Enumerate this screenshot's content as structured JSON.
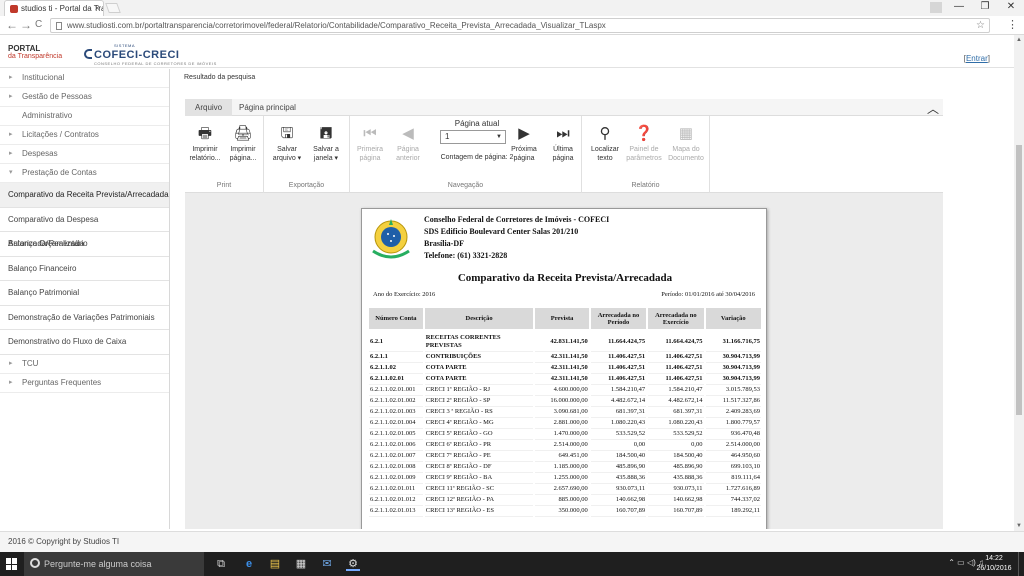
{
  "browser": {
    "tab_title": "studios ti - Portal da Tra",
    "tab_close": "×",
    "window_controls": [
      "—",
      "❐",
      "✕"
    ],
    "nav_back": "←",
    "nav_forward": "→",
    "nav_reload": "C",
    "url": "www.studiosti.com.br/portaltransparencia/corretorimovel/federal/Relatorio/Contabilidade/Comparativo_Receita_Prevista_Arrecadada_Visualizar_TLaspx",
    "star": "☆",
    "menu": "⋮"
  },
  "header": {
    "logo_line1": "PORTAL",
    "logo_line2": "da Transparência",
    "brand_system": "SISTEMA",
    "brand_name": "COFECI-CRECI",
    "brand_sub": "CONSELHO FEDERAL DE CORRETORES DE IMÓVEIS",
    "login_open": "[",
    "login_label": "Entrar",
    "login_close": "]"
  },
  "sidebar": {
    "sections": [
      {
        "label": "Institucional",
        "caret": "▸"
      },
      {
        "label": "Gestão de Pessoas",
        "caret": "▸"
      },
      {
        "label": "Administrativo",
        "caret": ""
      },
      {
        "label": "Licitações / Contratos",
        "caret": "▸"
      },
      {
        "label": "Despesas",
        "caret": "▸"
      },
      {
        "label": "Prestação de Contas",
        "caret": "▾"
      }
    ],
    "links": [
      "Comparativo da Receita Prevista/Arrecadada",
      "Comparativo da Despesa Autorizada/Realizada",
      "Balanço Orçamentário",
      "Balanço Financeiro",
      "Balanço Patrimonial",
      "Demonstração de Variações Patrimoniais",
      "Demonstrativo do Fluxo de Caixa"
    ],
    "tail_sections": [
      {
        "label": "TCU",
        "caret": "▸"
      },
      {
        "label": "Perguntas Frequentes",
        "caret": "▸"
      }
    ]
  },
  "content": {
    "result_title": "Resultado da pesquisa"
  },
  "viewer": {
    "tabs": [
      "Arquivo",
      "Página principal"
    ],
    "collapse_icon": "︿",
    "groups": {
      "print": "Print",
      "export": "Exportação",
      "nav": "Navegação",
      "report": "Relatório"
    },
    "buttons": {
      "print_report": [
        "Imprimir",
        "relatório..."
      ],
      "print_page": [
        "Imprimir",
        "página..."
      ],
      "save_file": [
        "Salvar",
        "arquivo ▾"
      ],
      "save_window": [
        "Salvar a",
        "janela ▾"
      ],
      "first_page": [
        "Primeira",
        "página"
      ],
      "prev_page": [
        "Página",
        "anterior"
      ],
      "next_page": [
        "Próxima",
        "página"
      ],
      "last_page": [
        "Última",
        "página"
      ],
      "find_text": [
        "Localizar",
        "texto"
      ],
      "param_panel": [
        "Painel de",
        "parâmetros"
      ],
      "doc_map": [
        "Mapa do",
        "Documento"
      ]
    },
    "page_label": "Página atual",
    "page_value": "1",
    "page_count": "Contagem de página: 2"
  },
  "report": {
    "org_lines": [
      "Conselho Federal de Corretores de Imóveis -  COFECI",
      "SDS Edificio Boulevard Center Salas 201/210",
      "Brasília-DF",
      "Telefone: (61) 3321-2828"
    ],
    "title": "Comparativo da Receita Prevista/Arrecadada",
    "ano": "Ano do Exercício: 2016",
    "periodo": "Período: 01/01/2016 até 30/04/2016",
    "columns": [
      "Número Conta",
      "Descrição",
      "Prevista",
      "Arrecadada no Período",
      "Arrecadada no Exercício",
      "Variação"
    ],
    "rows": [
      [
        "6.2.1",
        "RECEITAS CORRENTES PREVISTAS",
        "42.831.141,50",
        "11.664.424,75",
        "11.664.424,75",
        "31.166.716,75"
      ],
      [
        "6.2.1.1",
        "CONTRIBUIÇÕES",
        "42.311.141,50",
        "11.406.427,51",
        "11.406.427,51",
        "30.904.713,99"
      ],
      [
        "6.2.1.1.02",
        "COTA PARTE",
        "42.311.141,50",
        "11.406.427,51",
        "11.406.427,51",
        "30.904.713,99"
      ],
      [
        "6.2.1.1.02.01",
        "COTA PARTE",
        "42.311.141,50",
        "11.406.427,51",
        "11.406.427,51",
        "30.904.713,99"
      ],
      [
        "6.2.1.1.02.01.001",
        "CRECI 1ª REGIÃO - RJ",
        "4.600.000,00",
        "1.584.210,47",
        "1.584.210,47",
        "3.015.789,53"
      ],
      [
        "6.2.1.1.02.01.002",
        "CRECI 2ª REGIÃO - SP",
        "16.000.000,00",
        "4.482.672,14",
        "4.482.672,14",
        "11.517.327,86"
      ],
      [
        "6.2.1.1.02.01.003",
        "CRECI 3 ª REGIÃO - RS",
        "3.090.681,00",
        "681.397,31",
        "681.397,31",
        "2.409.283,69"
      ],
      [
        "6.2.1.1.02.01.004",
        "CRECI 4ª REGIÃO - MG",
        "2.881.000,00",
        "1.080.220,43",
        "1.080.220,43",
        "1.800.779,57"
      ],
      [
        "6.2.1.1.02.01.005",
        "CRECI 5ª REGIÃO - GO",
        "1.470.000,00",
        "533.529,52",
        "533.529,52",
        "936.470,48"
      ],
      [
        "6.2.1.1.02.01.006",
        "CRECI 6ª REGIÃO - PR",
        "2.514.000,00",
        "0,00",
        "0,00",
        "2.514.000,00"
      ],
      [
        "6.2.1.1.02.01.007",
        "CRECI 7ª REGIÃO - PE",
        "649.451,00",
        "184.500,40",
        "184.500,40",
        "464.950,60"
      ],
      [
        "6.2.1.1.02.01.008",
        "CRECI 8ª REGIÃO - DF",
        "1.185.000,00",
        "485.896,90",
        "485.896,90",
        "699.103,10"
      ],
      [
        "6.2.1.1.02.01.009",
        "CRECI 9ª REGIÃO - BA",
        "1.255.000,00",
        "435.888,36",
        "435.888,36",
        "819.111,64"
      ],
      [
        "6.2.1.1.02.01.011",
        "CRECI 11ª REGIÃO - SC",
        "2.657.690,00",
        "930.073,11",
        "930.073,11",
        "1.727.616,89"
      ],
      [
        "6.2.1.1.02.01.012",
        "CRECI 12ª REGIÃO - PA",
        "885.000,00",
        "140.662,98",
        "140.662,98",
        "744.337,02"
      ],
      [
        "6.2.1.1.02.01.013",
        "CRECI 13ª REGIÃO - ES",
        "350.000,00",
        "160.707,89",
        "160.707,89",
        "189.292,11"
      ]
    ]
  },
  "footer": {
    "text": "2016 © Copyright by Studios TI"
  },
  "taskbar": {
    "search_placeholder": "Pergunte-me alguma coisa",
    "icons": [
      "⧉",
      "e",
      "▤",
      "▦",
      "✉",
      "⚙"
    ],
    "tray": "⌃ ▭ ◁) ♫",
    "time": "14:22",
    "date": "26/10/2016"
  },
  "colors": {
    "brand_blue": "#2b4a7a",
    "logo_red": "#c0392b",
    "link_blue": "#2f6da8"
  }
}
